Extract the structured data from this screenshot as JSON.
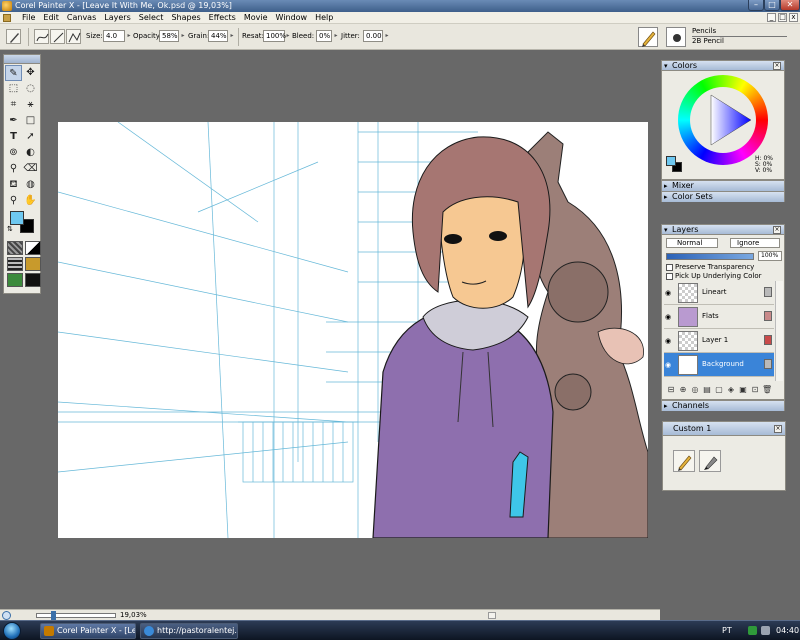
{
  "window": {
    "title": "Corel Painter X - [Leave It With Me, Ok.psd @ 19,03%]",
    "min_label": "–",
    "max_label": "□",
    "close_label": "✕"
  },
  "menu": {
    "items": [
      "File",
      "Edit",
      "Canvas",
      "Layers",
      "Select",
      "Shapes",
      "Effects",
      "Movie",
      "Window",
      "Help"
    ],
    "doc_buttons": [
      "_",
      "□",
      "x"
    ]
  },
  "propbar": {
    "size_label": "Size:",
    "size_value": "4.0",
    "opacity_label": "Opacity:",
    "opacity_value": "58%",
    "grain_label": "Grain:",
    "grain_value": "44%",
    "resat_label": "Resat:",
    "resat_value": "100%",
    "bleed_label": "Bleed:",
    "bleed_value": "0%",
    "jitter_label": "Jitter:",
    "jitter_value": "0.00",
    "brush_category": "Pencils",
    "brush_variant": "2B Pencil"
  },
  "colors": {
    "main": "#6ec8f0",
    "additional": "#000000",
    "accent": "#3a84d8"
  },
  "colors_panel": {
    "title": "Colors",
    "h": "H: 0%",
    "s": "S: 0%",
    "v": "V: 0%"
  },
  "mixer_panel": {
    "title": "Mixer"
  },
  "colorsets_panel": {
    "title": "Color Sets"
  },
  "layers_panel": {
    "title": "Layers",
    "blend_mode": "Normal",
    "composite": "Ignore",
    "opacity": "100%",
    "opacity_fraction": 1.0,
    "preserve_transparency": "Preserve Transparency",
    "pick_up_color": "Pick Up Underlying Color",
    "layers": [
      {
        "name": "Lineart",
        "selected": false
      },
      {
        "name": "Flats",
        "selected": false
      },
      {
        "name": "Layer 1",
        "selected": false
      },
      {
        "name": "Background",
        "selected": true
      }
    ]
  },
  "channels_panel": {
    "title": "Channels"
  },
  "custom_panel": {
    "title": "Custom 1"
  },
  "status": {
    "zoom": "19,03%",
    "zoom_fraction": 0.19
  },
  "taskbar": {
    "painter_task": "Corel Painter X - [Lea...",
    "browser_task": "http://pastoralentej...",
    "language": "PT",
    "clock": "04:40"
  },
  "icons": {
    "tools": [
      "brush-icon",
      "move-icon",
      "rectangle-select-icon",
      "lasso-icon",
      "crop-icon",
      "magic-wand-icon",
      "pen-icon",
      "shape-icon",
      "text-icon",
      "arrow-icon",
      "rubber-stamp-icon",
      "burn-icon",
      "dropper-icon",
      "eraser-icon",
      "paint-bucket-icon",
      "divine-proportion-icon",
      "magnifier-icon",
      "grabber-icon"
    ]
  }
}
